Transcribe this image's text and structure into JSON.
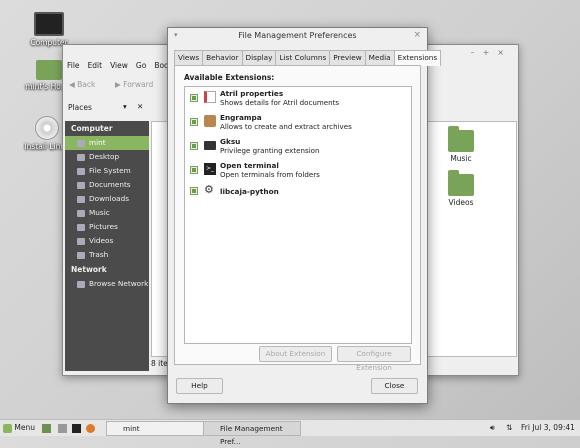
{
  "desktop": {
    "icons": [
      {
        "label": "Computer"
      },
      {
        "label": "mint's Home"
      },
      {
        "label": "Install Linux"
      }
    ]
  },
  "file_manager": {
    "menu": [
      "File",
      "Edit",
      "View",
      "Go",
      "Bookmarks"
    ],
    "toolbar": {
      "back": "Back",
      "forward": "Forward"
    },
    "places_label": "Places",
    "sidebar": {
      "computer_header": "Computer",
      "items": [
        "mint",
        "Desktop",
        "File System",
        "Documents",
        "Downloads",
        "Music",
        "Pictures",
        "Videos",
        "Trash"
      ],
      "network_header": "Network",
      "network_items": [
        "Browse Network"
      ]
    },
    "folders": [
      "Music",
      "Videos"
    ],
    "status": "8 ite"
  },
  "dialog": {
    "title": "File Management Preferences",
    "tabs": [
      "Views",
      "Behavior",
      "Display",
      "List Columns",
      "Preview",
      "Media",
      "Extensions"
    ],
    "active_tab": "Extensions",
    "section_title": "Available Extensions:",
    "extensions": [
      {
        "name": "Atril properties",
        "desc": "Shows details for Atril documents",
        "enabled": true
      },
      {
        "name": "Engrampa",
        "desc": "Allows to create and extract archives",
        "enabled": true
      },
      {
        "name": "Gksu",
        "desc": "Privilege granting extension",
        "enabled": true
      },
      {
        "name": "Open terminal",
        "desc": "Open terminals from folders",
        "enabled": true
      },
      {
        "name": "libcaja-python",
        "desc": "",
        "enabled": true
      }
    ],
    "about_button": "About Extension",
    "configure_button": "Configure Extension",
    "help_button": "Help",
    "close_button": "Close"
  },
  "taskbar": {
    "menu_label": "Menu",
    "windows": [
      "mint",
      "File Management Pref..."
    ],
    "clock": "Fri Jul 3, 09:41"
  },
  "colors": {
    "accent": "#8ab662",
    "sidebar_bg": "#4b4b4b"
  }
}
